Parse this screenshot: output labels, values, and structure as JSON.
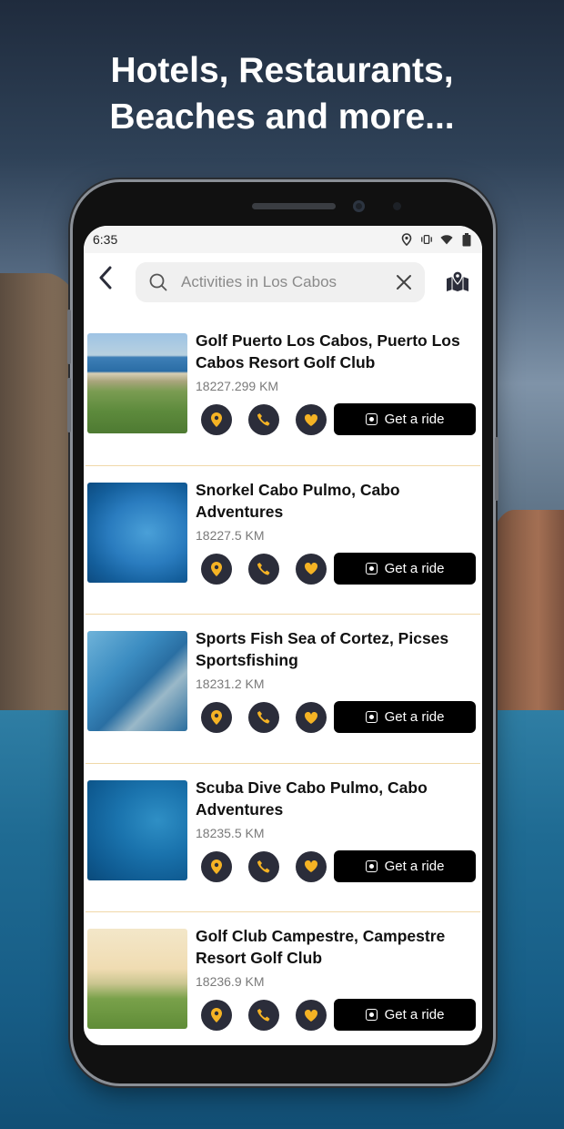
{
  "promo": {
    "headline_line1": "Hotels, Restaurants,",
    "headline_line2": "Beaches and more..."
  },
  "status_bar": {
    "time": "6:35"
  },
  "search": {
    "placeholder": "Activities in Los Cabos",
    "value": ""
  },
  "colors": {
    "action_button_bg": "#2b2d3a",
    "action_icon": "#f5b324",
    "ride_button_bg": "#000000",
    "divider": "#f0d8a8"
  },
  "activities": [
    {
      "title": "Golf Puerto Los Cabos, Puerto Los Cabos Resort Golf Club",
      "distance": "18227.299 KM",
      "ride_label": "Get a ride"
    },
    {
      "title": "Snorkel Cabo Pulmo, Cabo Adventures",
      "distance": "18227.5 KM",
      "ride_label": "Get a ride"
    },
    {
      "title": "Sports Fish Sea of Cortez, Picses Sportsfishing",
      "distance": "18231.2 KM",
      "ride_label": "Get a ride"
    },
    {
      "title": "Scuba Dive Cabo Pulmo, Cabo Adventures",
      "distance": "18235.5 KM",
      "ride_label": "Get a ride"
    },
    {
      "title": "Golf Club Campestre, Campestre Resort Golf Club",
      "distance": "18236.9 KM",
      "ride_label": "Get a ride"
    }
  ]
}
